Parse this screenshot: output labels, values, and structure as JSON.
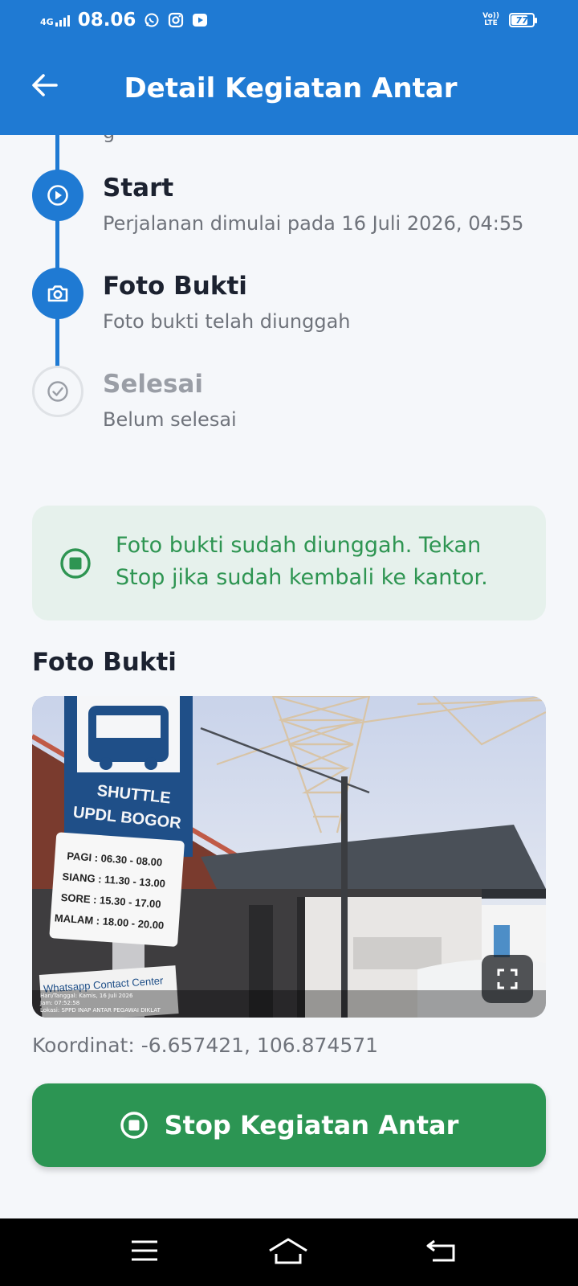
{
  "status_bar": {
    "network": "4G",
    "time": "08.06",
    "volte": [
      "Vo))",
      "LTE"
    ],
    "battery": "77",
    "notification_icons": [
      "whatsapp-icon",
      "instagram-icon",
      "youtube-icon"
    ]
  },
  "app_bar": {
    "title": "Detail Kegiatan Antar",
    "back_icon": "arrow-left-icon"
  },
  "timeline": {
    "cut_off_text": "g",
    "steps": [
      {
        "title": "Start",
        "subtitle": "Perjalanan dimulai pada 16 Juli 2026, 04:55",
        "state": "done",
        "icon": "play-circle-icon"
      },
      {
        "title": "Foto Bukti",
        "subtitle": "Foto bukti telah diunggah",
        "state": "done",
        "icon": "camera-icon"
      },
      {
        "title": "Selesai",
        "subtitle": "Belum selesai",
        "state": "pending",
        "icon": "check-circle-icon"
      }
    ]
  },
  "notice": {
    "text": "Foto bukti sudah diunggah. Tekan Stop jika sudah kembali ke kantor.",
    "icon": "stop-circle-icon"
  },
  "photo": {
    "heading": "Foto Bukti",
    "sign_title": [
      "SHUTTLE",
      "UPDL BOGOR"
    ],
    "schedule": [
      "PAGI : 06.30 - 08.00",
      "SIANG : 11.30 - 13.00",
      "SORE : 15.30 - 17.00",
      "MALAM : 18.00 - 20.00"
    ],
    "contact_sign": "Whatsapp Contact Center",
    "stamp": [
      "Hari/Tanggal: Kamis, 16 Juli 2026",
      "Jam: 07:52:58",
      "Lokasi: SPPD INAP ANTAR PEGAWAI DIKLAT"
    ],
    "expand_icon": "fullscreen-icon"
  },
  "coordinates": "Koordinat: -6.657421, 106.874571",
  "stop_button": {
    "label": "Stop Kegiatan Antar",
    "icon": "stop-circle-icon"
  },
  "nav_bar": {
    "icons": [
      "menu-icon",
      "home-icon",
      "back-icon"
    ]
  },
  "colors": {
    "primary": "#1f7ad3",
    "success": "#2c9553",
    "notice_bg": "#e6f1ec",
    "pending": "#9a9ea6"
  }
}
